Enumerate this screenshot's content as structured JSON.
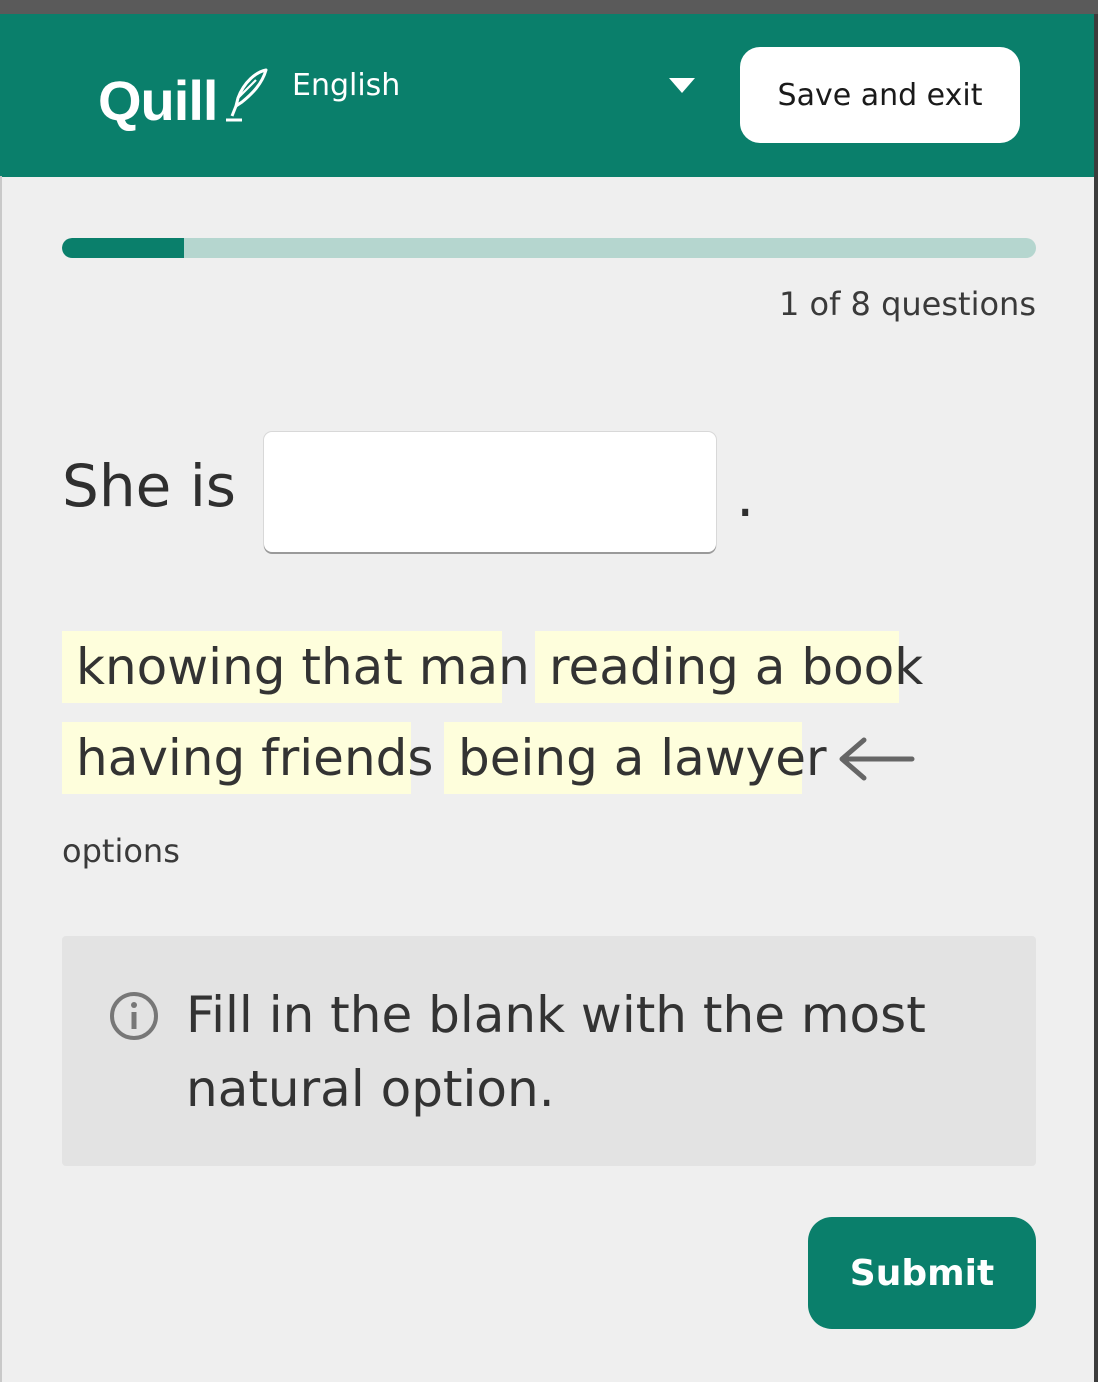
{
  "header": {
    "logo": "Quill",
    "language": "English",
    "save_label": "Save and exit",
    "brand_color": "#0a7f6b"
  },
  "progress": {
    "current": 1,
    "total": 8,
    "fraction": 0.125,
    "count_text": "1 of 8 questions"
  },
  "question": {
    "prompt_start": "She is",
    "blank_value": "",
    "prompt_end": "."
  },
  "options": [
    "knowing that man",
    "reading a book",
    "having friends",
    "being a lawyer"
  ],
  "options_label": "options",
  "icons": {
    "logo": "quill-pen-icon",
    "dropdown": "caret-down-icon",
    "options_pointer": "arrow-left-icon",
    "hint": "info-icon"
  },
  "hint": {
    "text": "Fill in the blank with the most natural option."
  },
  "submit_label": "Submit"
}
